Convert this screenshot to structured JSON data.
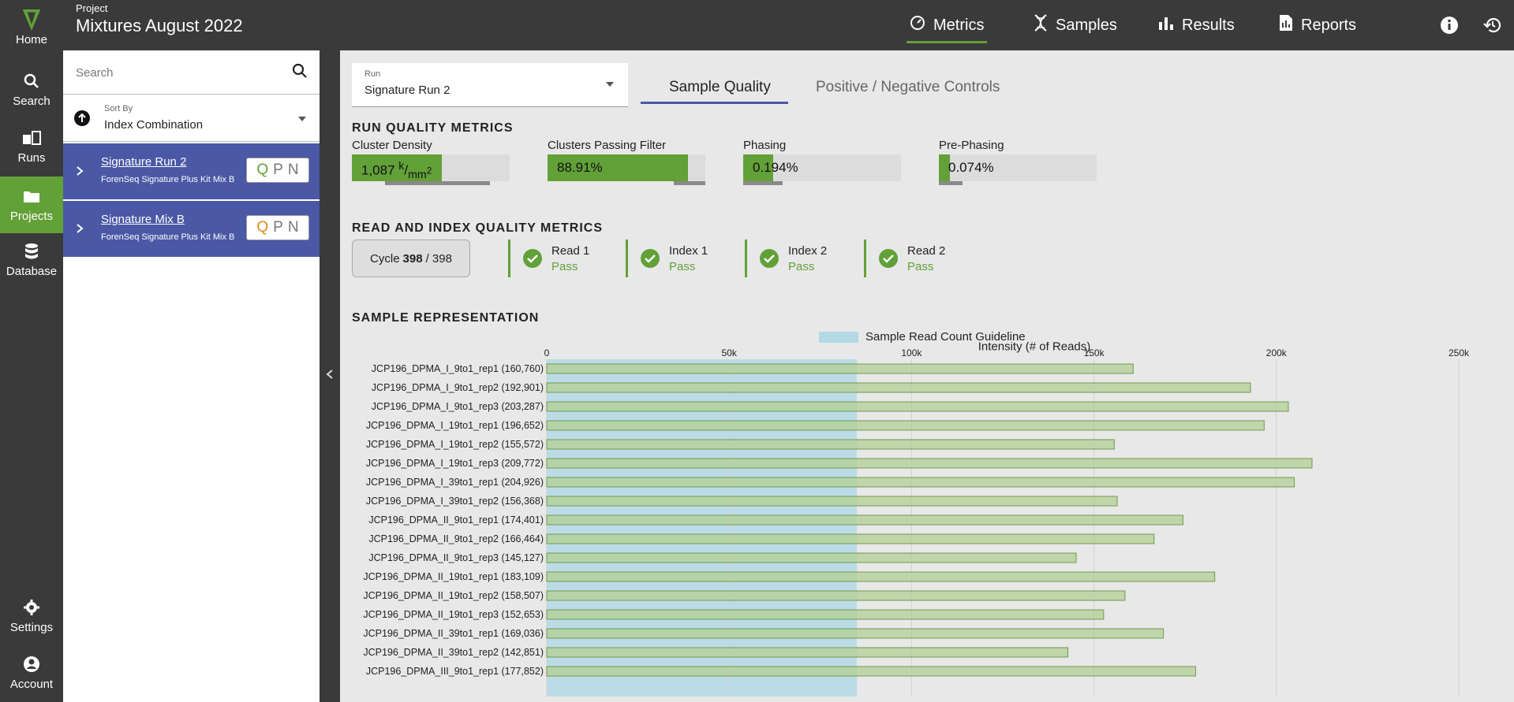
{
  "rail": {
    "items": [
      {
        "label": "Home",
        "icon": "v-logo-icon"
      },
      {
        "label": "Search",
        "icon": "search-icon"
      },
      {
        "label": "Runs",
        "icon": "runs-icon"
      },
      {
        "label": "Projects",
        "icon": "folder-icon"
      },
      {
        "label": "Database",
        "icon": "database-icon"
      },
      {
        "label": "Settings",
        "icon": "gear-icon"
      },
      {
        "label": "Account",
        "icon": "account-icon"
      }
    ]
  },
  "header": {
    "project_label": "Project",
    "project_name": "Mixtures August 2022",
    "nav": [
      {
        "label": "Metrics",
        "icon": "gauge-icon"
      },
      {
        "label": "Samples",
        "icon": "dna-icon"
      },
      {
        "label": "Results",
        "icon": "bar-chart-icon"
      },
      {
        "label": "Reports",
        "icon": "report-icon"
      }
    ]
  },
  "sidebar": {
    "search_placeholder": "Search",
    "sort_label": "Sort By",
    "sort_value": "Index Combination",
    "runs": [
      {
        "name": "Signature Run 2",
        "kit": "ForenSeq Signature Plus Kit Mix B",
        "q": "Q",
        "p": "P",
        "n": "N"
      },
      {
        "name": "Signature Mix B",
        "kit": "ForenSeq Signature Plus Kit Mix B",
        "q": "Q",
        "p": "P",
        "n": "N"
      }
    ]
  },
  "main": {
    "run_label": "Run",
    "run_value": "Signature Run 2",
    "tabs": [
      "Sample Quality",
      "Positive / Negative Controls"
    ],
    "run_quality_title": "RUN QUALITY METRICS",
    "metrics": [
      {
        "label": "Cluster Density",
        "value": "1,087",
        "fill": 0.57
      },
      {
        "label": "Clusters Passing Filter",
        "value": "88.91%",
        "fill": 0.89
      },
      {
        "label": "Phasing",
        "value": "0.194%",
        "fill": 0.19
      },
      {
        "label": "Pre-Phasing",
        "value": "0.074%",
        "fill": 0.07
      }
    ],
    "density_unit": "k",
    "density_unit_sub": "mm",
    "density_unit_exp": "2",
    "read_index_title": "READ AND INDEX QUALITY METRICS",
    "cycle_label": "Cycle",
    "cycle_current": "398",
    "cycle_total": "/ 398",
    "reads": [
      {
        "name": "Read 1",
        "status": "Pass"
      },
      {
        "name": "Index 1",
        "status": "Pass"
      },
      {
        "name": "Index 2",
        "status": "Pass"
      },
      {
        "name": "Read 2",
        "status": "Pass"
      }
    ],
    "sample_rep_title": "SAMPLE REPRESENTATION",
    "legend_label": "Sample Read Count Guideline",
    "colors": {
      "accent_green": "#62a038",
      "accent_blue": "#4a58a6",
      "guideline": "#b3d9e6",
      "bar": "#b5cf9a"
    }
  },
  "chart_data": {
    "type": "bar",
    "orientation": "horizontal",
    "title": "Intensity (# of Reads)",
    "xlim": [
      0,
      250000
    ],
    "xticks": [
      0,
      50000,
      100000,
      150000,
      200000,
      250000
    ],
    "xtick_labels": [
      "0",
      "50k",
      "100k",
      "150k",
      "200k",
      "250k"
    ],
    "guideline_range": [
      0,
      85000
    ],
    "categories": [
      "JCP196_DPMA_I_9to1_rep1 (160,760)",
      "JCP196_DPMA_I_9to1_rep2 (192,901)",
      "JCP196_DPMA_I_9to1_rep3 (203,287)",
      "JCP196_DPMA_I_19to1_rep1 (196,652)",
      "JCP196_DPMA_I_19to1_rep2 (155,572)",
      "JCP196_DPMA_I_19to1_rep3 (209,772)",
      "JCP196_DPMA_I_39to1_rep1 (204,926)",
      "JCP196_DPMA_I_39to1_rep2 (156,368)",
      "JCP196_DPMA_II_9to1_rep1 (174,401)",
      "JCP196_DPMA_II_9to1_rep2 (166,464)",
      "JCP196_DPMA_II_9to1_rep3 (145,127)",
      "JCP196_DPMA_II_19to1_rep1 (183,109)",
      "JCP196_DPMA_II_19to1_rep2 (158,507)",
      "JCP196_DPMA_II_19to1_rep3 (152,653)",
      "JCP196_DPMA_II_39to1_rep1 (169,036)",
      "JCP196_DPMA_II_39to1_rep2 (142,851)",
      "JCP196_DPMA_III_9to1_rep1 (177,852)"
    ],
    "values": [
      160760,
      192901,
      203287,
      196652,
      155572,
      209772,
      204926,
      156368,
      174401,
      166464,
      145127,
      183109,
      158507,
      152653,
      169036,
      142851,
      177852
    ]
  }
}
